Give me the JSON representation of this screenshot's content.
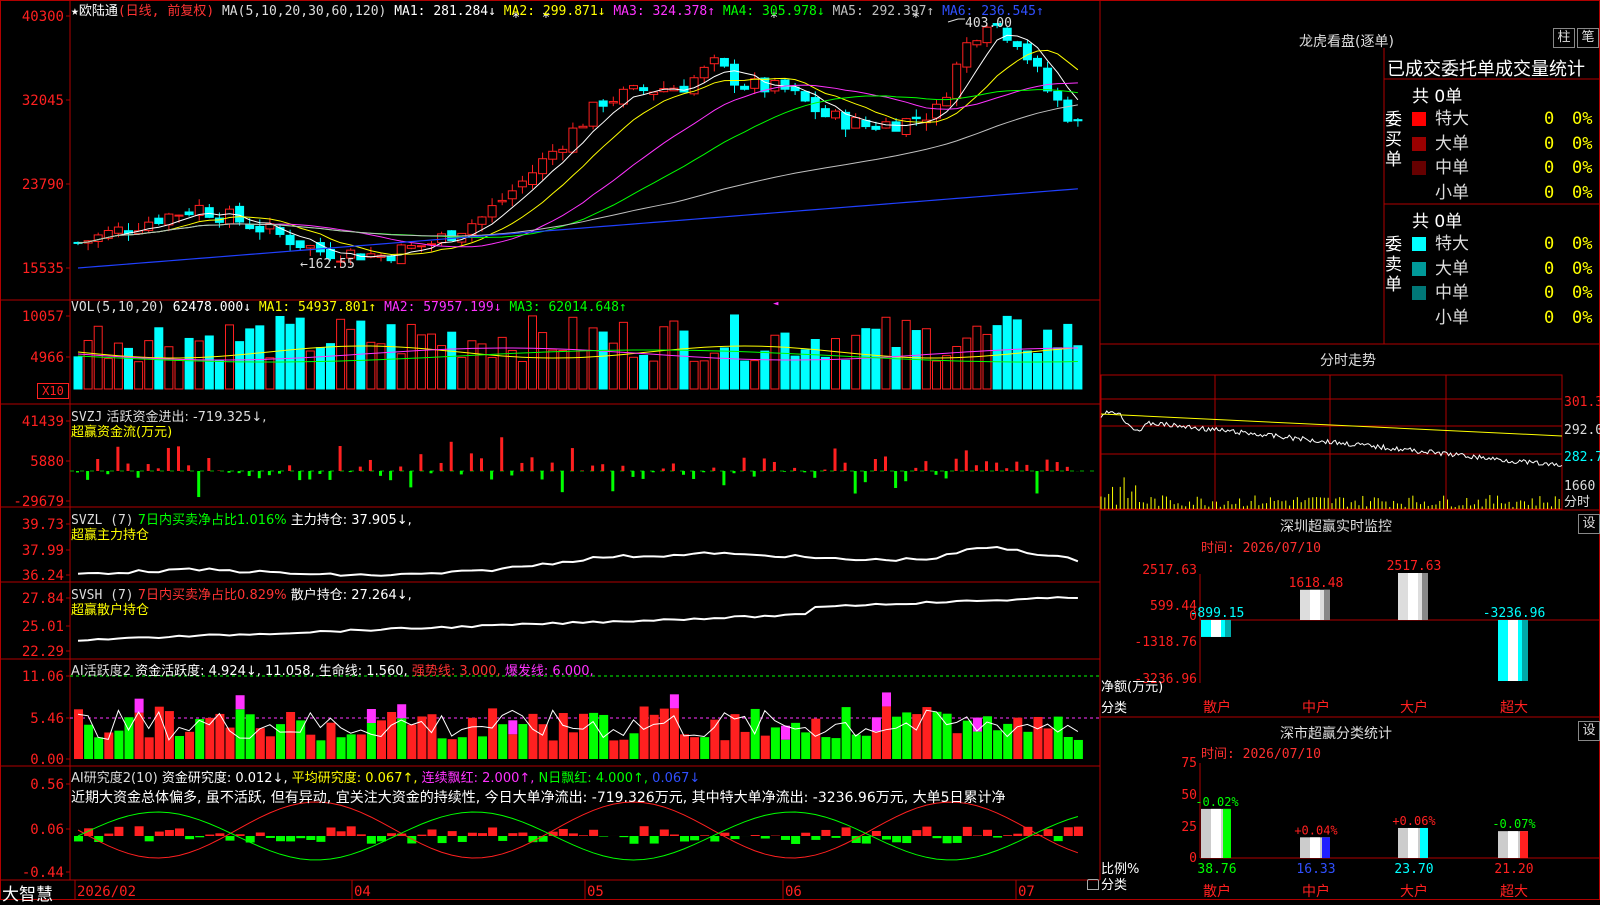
{
  "main": {
    "title_icon": "★",
    "stock_name": "欧陆通",
    "mode": "(日线, 前复权)",
    "ma_params": "MA(5,10,20,30,60,120)",
    "ma_values": [
      {
        "label": "MA1: 281.284↓",
        "color": "#ffffff"
      },
      {
        "label": "MA2: 299.871↓",
        "color": "#ffff00"
      },
      {
        "label": "MA3: 324.378↑",
        "color": "#ff33ff"
      },
      {
        "label": "MA4: 305.978↓",
        "color": "#00ff00"
      },
      {
        "label": "MA5: 292.397↑",
        "color": "#c0c0c0"
      },
      {
        "label": "MA6: 236.545↑",
        "color": "#3050ff"
      }
    ],
    "y_ticks": [
      "40300",
      "32045",
      "23790",
      "15535"
    ],
    "high_label": "403.00",
    "low_label": "162.55"
  },
  "vol": {
    "params": "VOL(5,10,20)",
    "value": "62478.000↓",
    "ma_values": [
      {
        "label": "MA1: 54937.801↑",
        "color": "#ffff00"
      },
      {
        "label": "MA2: 57957.199↓",
        "color": "#ff33ff"
      },
      {
        "label": "MA3: 62014.648↑",
        "color": "#00ff00"
      }
    ],
    "y_ticks": [
      "10057",
      "4966"
    ],
    "unit_badge": "X10"
  },
  "svzj": {
    "params": "SVZJ",
    "text": "活跃资金进出: -719.325↓,",
    "subtitle": "超赢资金流(万元)",
    "y_ticks": [
      "41439",
      "5880",
      "-29679"
    ]
  },
  "svzl": {
    "params": "SVZL (7)",
    "text_green": "7日内买卖净占比1.016%",
    "text_white": "主力持仓: 37.905↓,",
    "subtitle": "超赢主力持仓",
    "y_ticks": [
      "39.73",
      "37.99",
      "36.24"
    ]
  },
  "svsh": {
    "params": "SVSH (7)",
    "text_red": "7日内买卖净占比0.829%",
    "text_white": "散户持仓: 27.264↓,",
    "subtitle": "超赢散户持仓",
    "y_ticks": [
      "27.84",
      "25.01",
      "22.29"
    ]
  },
  "ai1": {
    "params": "AI活跃度2",
    "text1": "资金活跃度: 4.924↓, 11.058,",
    "text2": "生命线: 1.560,",
    "text3": "强势线: 3.000,",
    "text4": "爆发线: 6.000,",
    "y_ticks": [
      "11.06",
      "5.46",
      "0.00"
    ]
  },
  "ai2": {
    "params": "AI研究度2(10)",
    "text1": "资金研究度: 0.012↓,",
    "text2": "平均研究度: 0.067↑,",
    "text3": "连续飘红: 2.000↑,",
    "text4": "N日飘红: 4.000↑,",
    "text5": "0.067↓",
    "comment": "近期大资金总体偏多, 虽不活跃, 但有异动, 宜关注大资金的持续性, 今日大单净流出: -719.326万元, 其中特大单净流出: -3236.96万元, 大单5日累计净",
    "y_ticks": [
      "0.56",
      "0.06",
      "-0.44"
    ]
  },
  "xaxis": {
    "brand": "大智慧",
    "labels": [
      "2026/02",
      "04",
      "05",
      "06",
      "07"
    ]
  },
  "right": {
    "lhb_title": "龙虎看盘(逐单)",
    "btn_zhu": "柱",
    "btn_bi": "笔",
    "ob_header": "已成交委托单成交量统计",
    "buy_side": "委买单",
    "sell_side": "委卖单",
    "buy_total": "共 0单",
    "sell_total": "共 0单",
    "buy_rows": [
      {
        "label": "特大",
        "value": "0",
        "pct": "0%",
        "color": "#ff0000"
      },
      {
        "label": "大单",
        "value": "0",
        "pct": "0%",
        "color": "#990000"
      },
      {
        "label": "中单",
        "value": "0",
        "pct": "0%",
        "color": "#660000"
      },
      {
        "label": "小单",
        "value": "0",
        "pct": "0%",
        "color": "#000000"
      }
    ],
    "sell_rows": [
      {
        "label": "特大",
        "value": "0",
        "pct": "0%",
        "color": "#00ffff"
      },
      {
        "label": "大单",
        "value": "0",
        "pct": "0%",
        "color": "#009999"
      },
      {
        "label": "中单",
        "value": "0",
        "pct": "0%",
        "color": "#007777"
      },
      {
        "label": "小单",
        "value": "0",
        "pct": "0%",
        "color": "#000000"
      }
    ],
    "intraday_title": "分时走势",
    "intraday_ticks": [
      "301.3",
      "292.0",
      "282.7",
      "1660",
      "分时"
    ],
    "monitor_title": "深圳超赢实时监控",
    "monitor_time": "时间: 2026/07/10",
    "monitor_yticks": [
      "2517.63",
      "599.44",
      "0",
      "-1318.76",
      "-3236.96"
    ],
    "monitor_ylabel": "净额(万元)",
    "monitor_xlabel": "分类",
    "monitor_bars": [
      {
        "cat": "散户",
        "value": -899.15,
        "label": "-899.15"
      },
      {
        "cat": "中户",
        "value": 1618.48,
        "label": "1618.48"
      },
      {
        "cat": "大户",
        "value": 2517.63,
        "label": "2517.63"
      },
      {
        "cat": "超大",
        "value": -3236.96,
        "label": "-3236.96"
      }
    ],
    "class_title": "深市超赢分类统计",
    "class_time": "时间: 2026/07/10",
    "class_yticks": [
      "75",
      "50",
      "25",
      "0"
    ],
    "class_ylabel": "比例%",
    "class_xlabel": "分类",
    "class_bars": [
      {
        "cat": "散户",
        "value": 38.76,
        "label": "38.76",
        "delta": "-0.02%",
        "color": "#00ff00"
      },
      {
        "cat": "中户",
        "value": 16.33,
        "label": "16.33",
        "delta": "+0.04%",
        "color": "#2020ff"
      },
      {
        "cat": "大户",
        "value": 23.7,
        "label": "23.70",
        "delta": "+0.06%",
        "color": "#00ffff"
      },
      {
        "cat": "超大",
        "value": 21.2,
        "label": "21.20",
        "delta": "-0.07%",
        "color": "#ff2020"
      }
    ],
    "gear": "设"
  }
}
